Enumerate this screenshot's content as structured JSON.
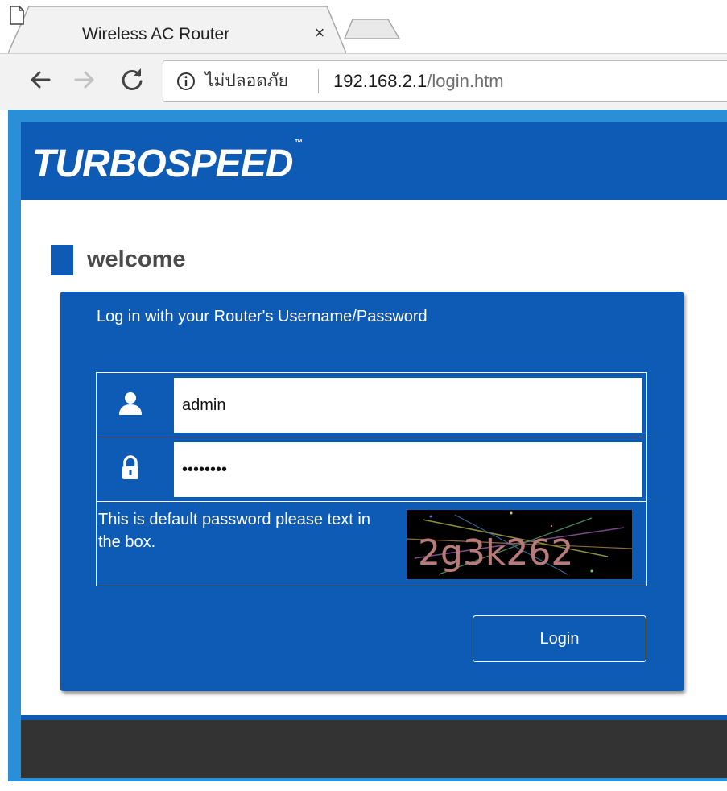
{
  "browser": {
    "tab_title": "Wireless AC Router",
    "tab_close": "×",
    "security_label": "ไม่ปลอดภัย",
    "url_host": "192.168.2.1",
    "url_path": "/login.htm",
    "icons": {
      "back": "back-arrow-icon",
      "forward": "forward-arrow-icon",
      "reload": "reload-icon",
      "info": "info-icon",
      "favicon": "page-icon"
    }
  },
  "page": {
    "logo": "TURBOSPEED",
    "logo_tm": "™",
    "welcome": "welcome",
    "login": {
      "title": "Log in with your Router's Username/Password",
      "username_value": "admin",
      "password_value": "••••••••",
      "captcha_hint": "This is default password please text in the box.",
      "captcha_text": "2g3k262",
      "button_label": "Login"
    }
  },
  "colors": {
    "brand_blue": "#0e5bb5",
    "frame_blue": "#2a8fd6",
    "footer_dark": "#333333"
  }
}
